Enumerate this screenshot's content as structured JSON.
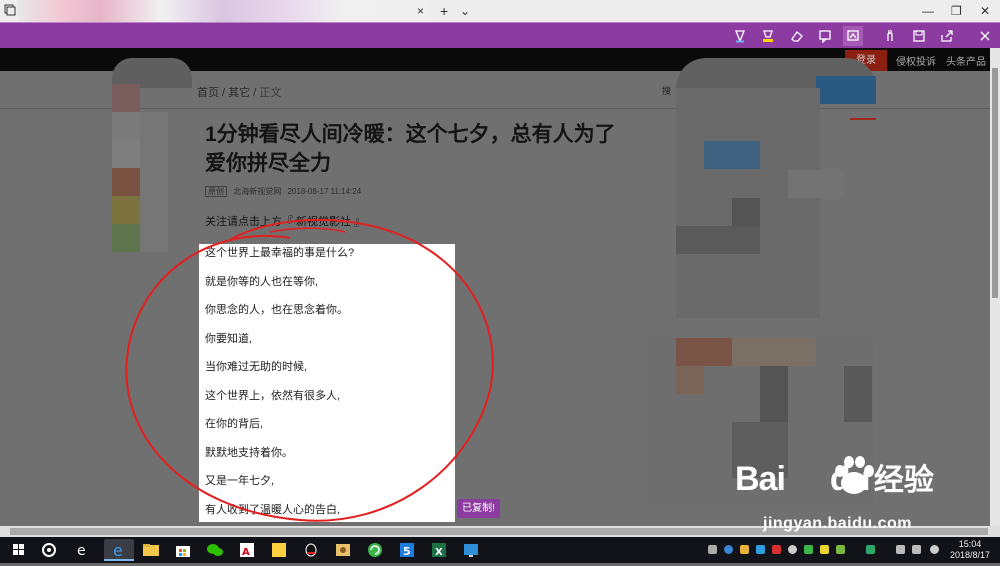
{
  "browser": {
    "new_tab_symbol": "+",
    "tab_list_symbol": "⌄",
    "close_tab_symbol": "×",
    "window_controls": {
      "minimize": "—",
      "maximize": "❐",
      "close": "✕"
    }
  },
  "toolbar_tools": [
    "pen-icon",
    "highlighter-icon",
    "eraser-icon",
    "comment-icon",
    "clip-icon",
    "touch-write-icon",
    "save-icon",
    "share-icon",
    "exit-icon"
  ],
  "site": {
    "login_label": "登录",
    "nav_links": [
      "侵权投诉",
      "头条产品"
    ],
    "breadcrumb": {
      "home": "首页",
      "sep1": " / ",
      "other": "其它",
      "sep2": " / ",
      "current": "正文"
    },
    "headline": "1分钟看尽人间冷暖：这个七夕，总有人为了爱你拼尽全力",
    "meta": {
      "badge": "原创",
      "source": "北海新视觉网",
      "datetime": "2018-08-17 11:14:24"
    },
    "follow_text": "关注请点击上方『 新视觉影社 』",
    "side_search": "搜"
  },
  "selection": {
    "lines": [
      "这个世界上最幸福的事是什么?",
      "就是你等的人也在等你,",
      "你思念的人，也在思念着你。",
      "你要知道,",
      "当你难过无助的时候,",
      "这个世界上，依然有很多人,",
      "在你的背后,",
      "默默地支持着你。",
      "又是一年七夕,",
      "有人收到了温暖人心的告白,"
    ],
    "copied_badge": "已复制!"
  },
  "watermark": {
    "brand": "Bai",
    "brand2": "du",
    "cn": "经验",
    "url": "jingyan.baidu.com"
  },
  "taskbar": {
    "time": "15:04",
    "date": "2018/8/17",
    "apps": [
      "start-icon",
      "search-icon",
      "edge-legacy-icon",
      "edge-icon",
      "file-explorer-icon",
      "store-icon",
      "wechat-icon",
      "pdf-icon",
      "sticky-icon",
      "qq-icon",
      "box-icon",
      "refresh-icon",
      "s5-icon",
      "excel-icon",
      "board-icon"
    ]
  },
  "colors": {
    "accent_purple": "#8c3ba0",
    "annotation_red": "#e32020"
  }
}
